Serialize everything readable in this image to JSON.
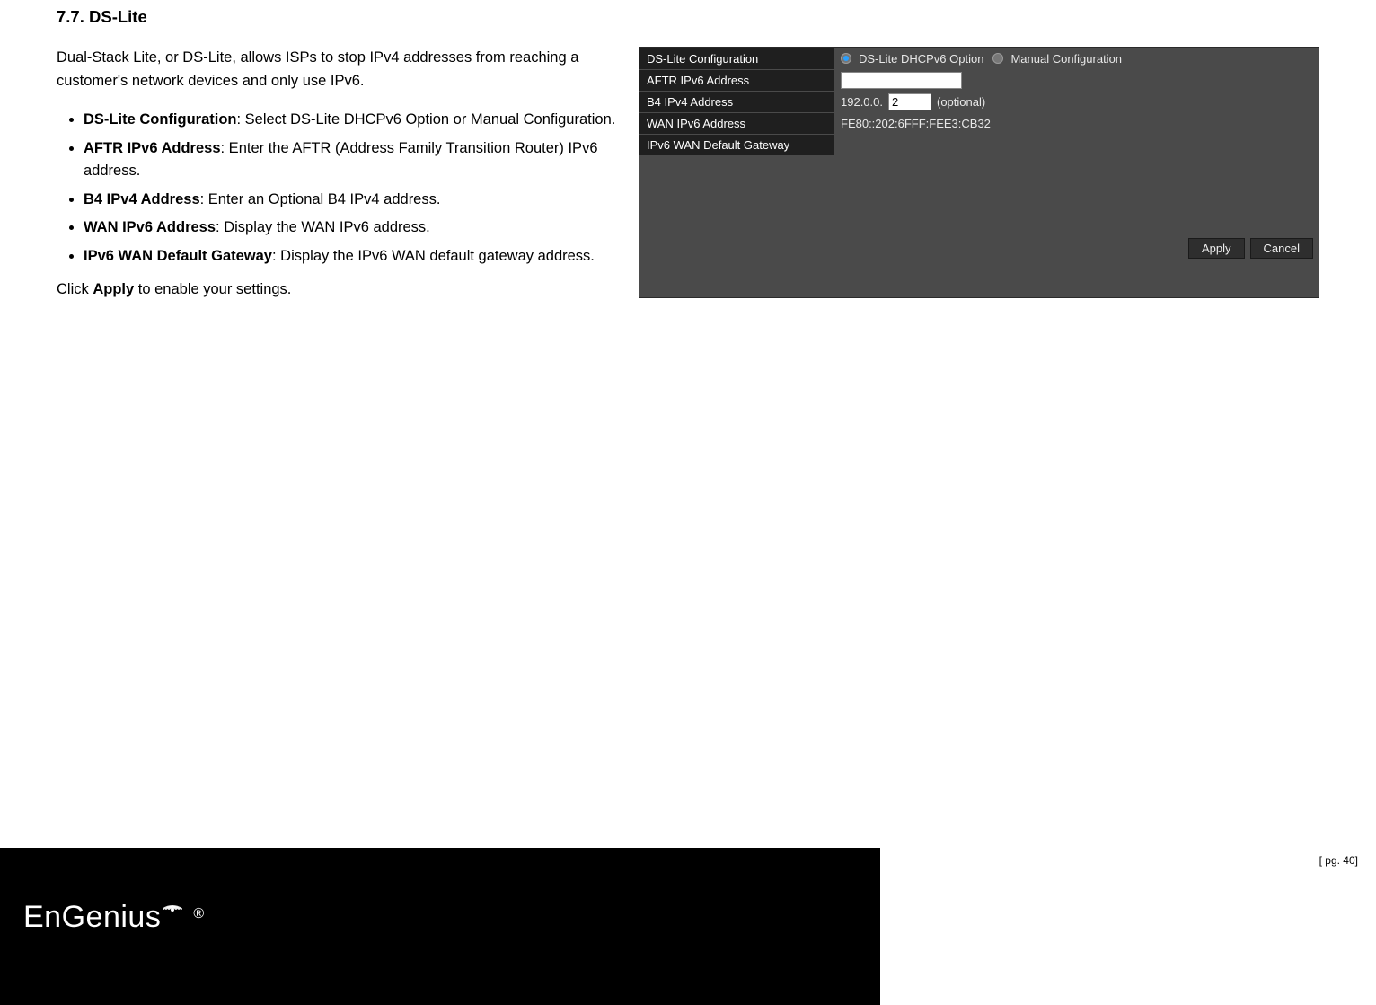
{
  "section": {
    "number": "7.7.",
    "title": "DS-Lite"
  },
  "intro": "Dual-Stack Lite, or DS-Lite, allows ISPs to stop IPv4 addresses from reaching a customer's network devices and only use IPv6.",
  "fields": [
    {
      "name": "DS-Lite Configuration",
      "desc": ": Select DS-Lite DHCPv6 Option or Manual Configuration."
    },
    {
      "name": "AFTR IPv6 Address",
      "desc": ": Enter the AFTR (Address Family Transition Router) IPv6 address."
    },
    {
      "name": "B4 IPv4 Address",
      "desc": ": Enter an Optional B4 IPv4 address."
    },
    {
      "name": "WAN IPv6 Address",
      "desc": ": Display the WAN IPv6 address."
    },
    {
      "name": "IPv6 WAN Default Gateway",
      "desc": ": Display the IPv6 WAN default gateway address."
    }
  ],
  "closing_pre": "Click ",
  "closing_bold": "Apply",
  "closing_post": " to enable your settings.",
  "panel": {
    "rows": {
      "config_label": "DS-Lite Configuration",
      "config_opt1": "DS-Lite DHCPv6 Option",
      "config_opt2": "Manual Configuration",
      "config_selected": "opt1",
      "aftr_label": "AFTR IPv6 Address",
      "aftr_value": "",
      "b4_label": "B4 IPv4 Address",
      "b4_prefix": "192.0.0.",
      "b4_value": "2",
      "b4_suffix": "(optional)",
      "wan_label": "WAN IPv6 Address",
      "wan_value": "FE80::202:6FFF:FEE3:CB32",
      "gw_label": "IPv6 WAN Default Gateway",
      "gw_value": ""
    },
    "buttons": {
      "apply": "Apply",
      "cancel": "Cancel"
    }
  },
  "footer": {
    "brand": "EnGenius",
    "reg": "®",
    "page": "[ pg. 40]"
  }
}
